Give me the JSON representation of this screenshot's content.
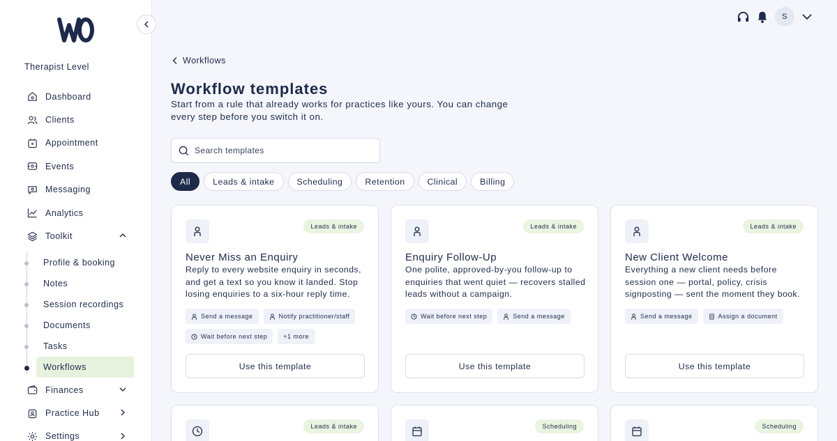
{
  "brand": {
    "level": "Therapist Level"
  },
  "sidebar": {
    "items": [
      {
        "label": "Dashboard",
        "icon": "home-icon"
      },
      {
        "label": "Clients",
        "icon": "users-icon"
      },
      {
        "label": "Appointment",
        "icon": "calendar-icon"
      },
      {
        "label": "Events",
        "icon": "ticket-icon"
      },
      {
        "label": "Messaging",
        "icon": "chat-icon"
      },
      {
        "label": "Analytics",
        "icon": "chart-icon"
      },
      {
        "label": "Toolkit",
        "icon": "layers-icon"
      }
    ],
    "toolkit_items": [
      {
        "label": "Profile & booking"
      },
      {
        "label": "Notes"
      },
      {
        "label": "Session recordings"
      },
      {
        "label": "Documents"
      },
      {
        "label": "Tasks"
      },
      {
        "label": "Workflows"
      }
    ],
    "bottom_items": [
      {
        "label": "Finances",
        "icon": "wallet-icon"
      },
      {
        "label": "Practice Hub",
        "icon": "clipboard-icon"
      },
      {
        "label": "Settings",
        "icon": "gear-icon"
      }
    ]
  },
  "header": {
    "avatar_initial": "S"
  },
  "breadcrumb": {
    "label": "Workflows"
  },
  "page": {
    "title": "Workflow templates",
    "description": "Start from a rule that already works for practices like yours. You can change every step before you switch it on."
  },
  "search": {
    "placeholder": "Search templates"
  },
  "filters": [
    "All",
    "Leads & intake",
    "Scheduling",
    "Retention",
    "Clinical",
    "Billing"
  ],
  "cards": [
    {
      "tag": "Leads & intake",
      "title": "Never Miss an Enquiry",
      "description": "Reply to every website enquiry in seconds, and get a text so you know it landed. Stop losing enquiries to a six-hour reply time.",
      "steps": [
        {
          "label": "Send a message"
        },
        {
          "label": "Notify practitioner/staff"
        },
        {
          "label": "Wait before next step"
        },
        {
          "label": "+1 more"
        }
      ],
      "button": "Use this template"
    },
    {
      "tag": "Leads & intake",
      "title": "Enquiry Follow-Up",
      "description": "One polite, approved-by-you follow-up to enquiries that went quiet — recovers stalled leads without a campaign.",
      "steps": [
        {
          "label": "Wait before next step"
        },
        {
          "label": "Send a message"
        }
      ],
      "button": "Use this template"
    },
    {
      "tag": "Leads & intake",
      "title": "New Client Welcome",
      "description": "Everything a new client needs before session one — portal, policy, crisis signposting — sent the moment they book.",
      "steps": [
        {
          "label": "Send a message"
        },
        {
          "label": "Assign a document"
        }
      ],
      "button": "Use this template"
    }
  ],
  "cards_row2": [
    {
      "tag": "Leads & intake"
    },
    {
      "tag": "Scheduling"
    },
    {
      "tag": "Scheduling"
    }
  ],
  "colors": {
    "navy": "#1e2a4a",
    "tag_green": "#e9f4e1",
    "active_nav": "#e6f2dd"
  }
}
